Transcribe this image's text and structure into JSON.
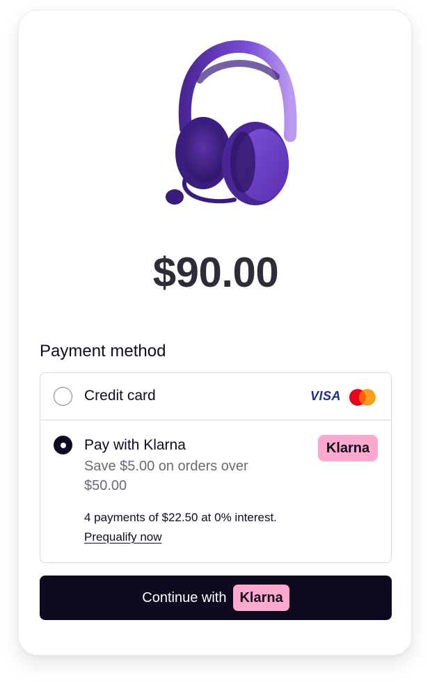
{
  "product": {
    "image_icon": "headphones-icon",
    "image_color": "#6a3fc7",
    "price": "$90.00"
  },
  "payment": {
    "section_title": "Payment method",
    "methods": [
      {
        "id": "credit-card",
        "label": "Credit card",
        "selected": false,
        "brands": [
          "VISA",
          "mastercard-icon"
        ]
      },
      {
        "id": "klarna",
        "label": "Pay with Klarna",
        "selected": true,
        "subtitle": "Save $5.00 on orders over $50.00",
        "badge": "Klarna",
        "installments_text": "4 payments of $22.50 at 0% interest.",
        "prequalify_link": "Prequalify now"
      }
    ]
  },
  "continue_button": {
    "label": "Continue with",
    "badge": "Klarna"
  },
  "colors": {
    "primary": "#0e0a1f",
    "klarna_pink": "#ffa8cd",
    "visa_blue": "#1a2b9b",
    "price_text": "#2e2b3a"
  }
}
